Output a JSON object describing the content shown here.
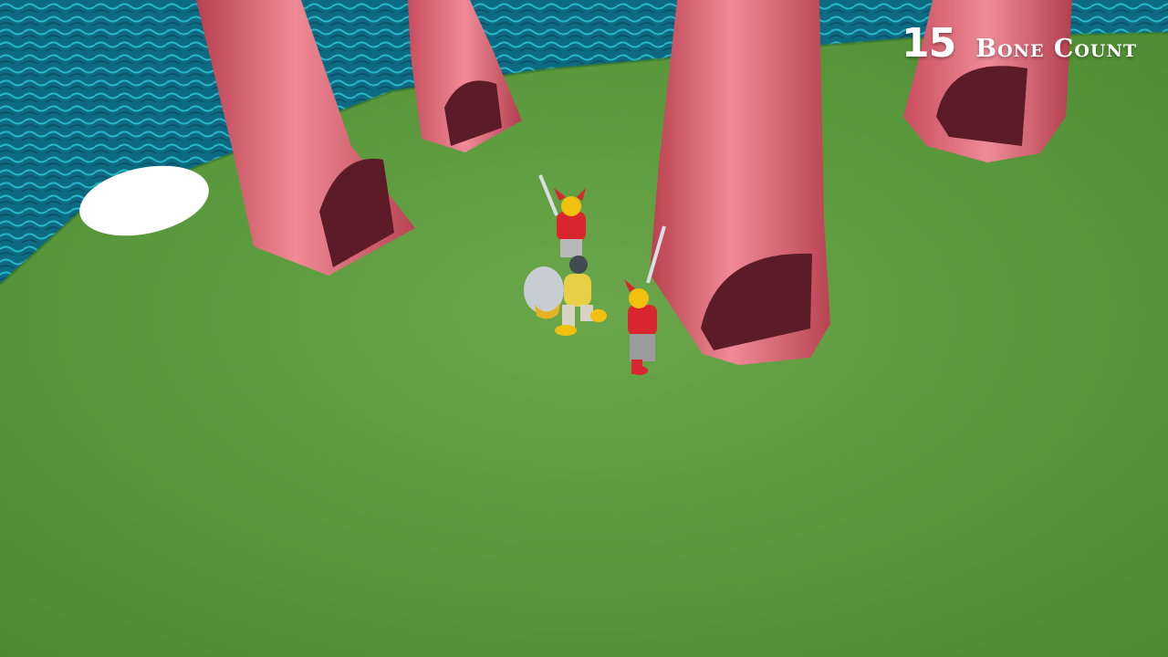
{
  "hud": {
    "bone_count": "15",
    "bone_count_label": "Bone Count"
  },
  "scene": {
    "colors": {
      "water": "#0f6e86",
      "grass": "#5d9a3f",
      "dinosaur_feet": "#d85f72",
      "enemy_armor": "#d9252e",
      "enemy_helmet": "#f2c10f",
      "hero_outfit": "#e8d044"
    },
    "entities": {
      "enemy_warriors": 2,
      "hero": 1,
      "giant_feet": 4,
      "bone_piles": 1
    }
  }
}
